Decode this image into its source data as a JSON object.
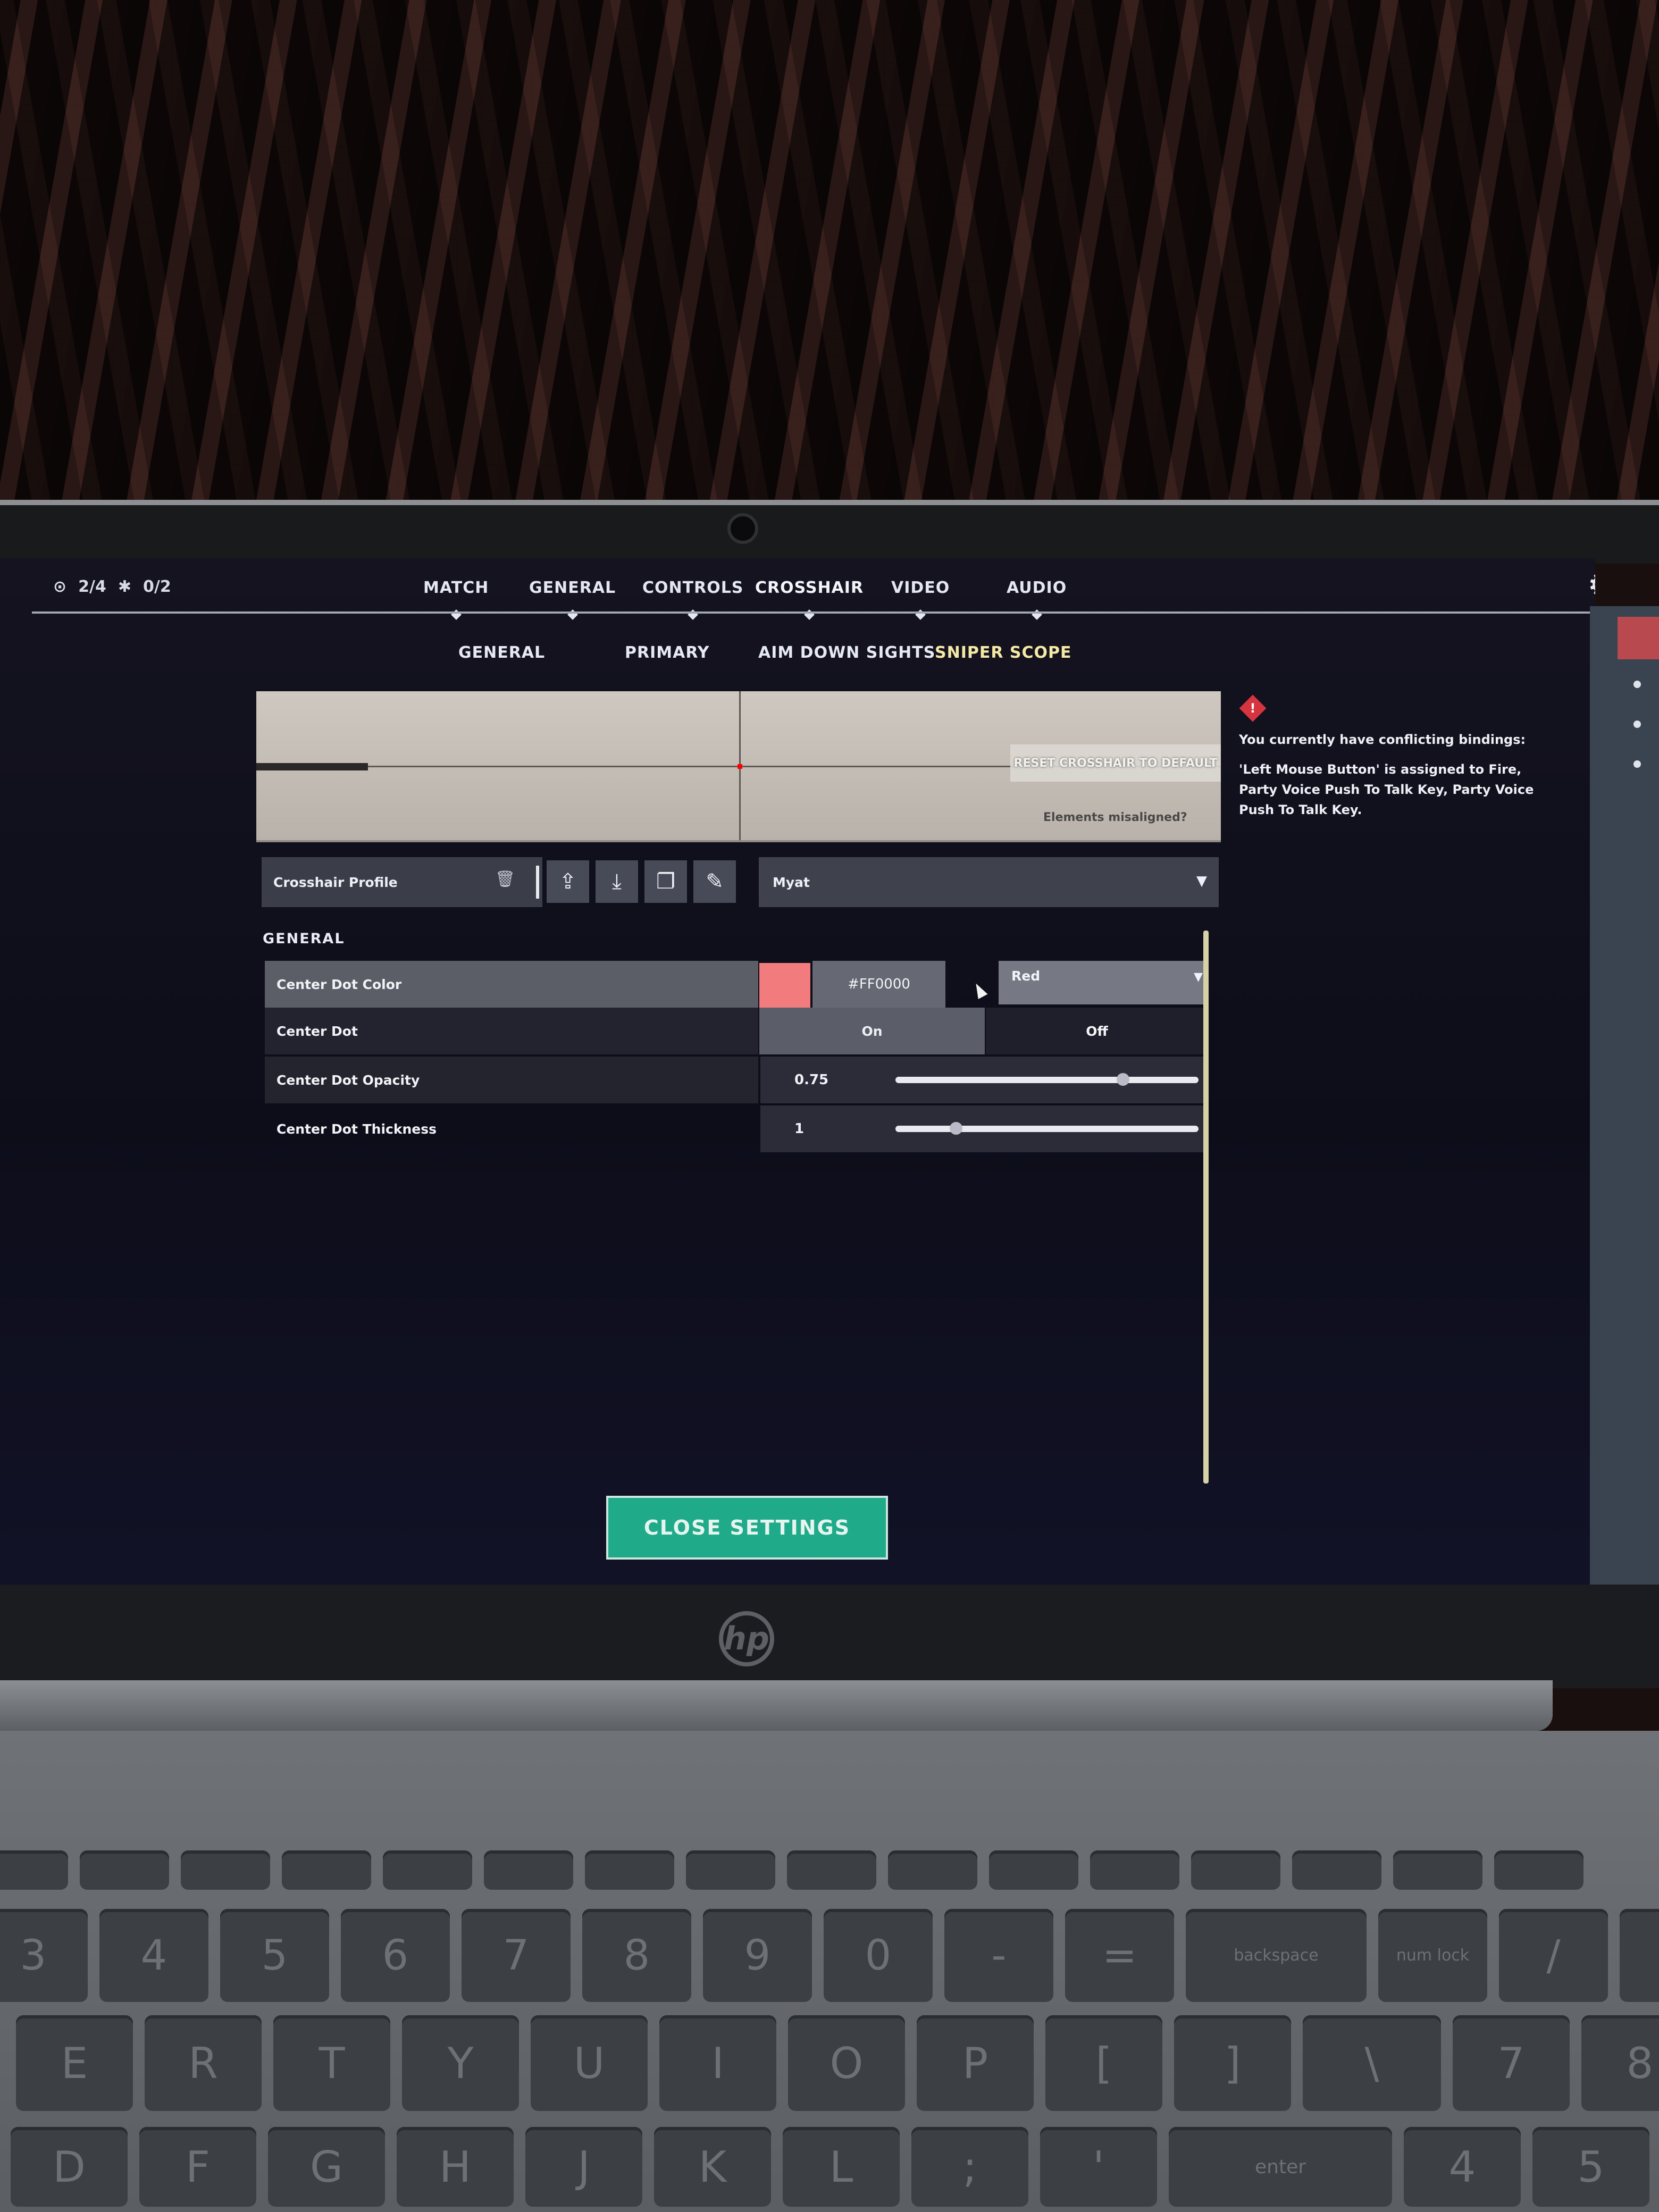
{
  "topbar": {
    "stats": {
      "agents": "2/4",
      "ability": "0/2"
    },
    "tabs": [
      "MATCH",
      "GENERAL",
      "CONTROLS",
      "CROSSHAIR",
      "VIDEO",
      "AUDIO"
    ],
    "active_tab": "CROSSHAIR"
  },
  "subtabs": {
    "items": [
      "GENERAL",
      "PRIMARY",
      "AIM DOWN SIGHTS",
      "SNIPER SCOPE"
    ],
    "active": "SNIPER SCOPE"
  },
  "preview": {
    "reset_label": "RESET CROSSHAIR TO DEFAULT",
    "misaligned_label": "Elements misaligned?"
  },
  "conflict": {
    "heading": "You currently have conflicting bindings:",
    "detail": "'Left Mouse Button' is assigned to Fire, Party Voice Push To Talk Key, Party Voice Push To Talk Key."
  },
  "profile": {
    "label": "Crosshair Profile",
    "selected": "Myat"
  },
  "section": {
    "title": "GENERAL"
  },
  "settings": {
    "center_dot_color": {
      "label": "Center Dot Color",
      "hex": "#FF0000",
      "color_name": "Red",
      "swatch_color": "#FF0000"
    },
    "center_dot": {
      "label": "Center Dot",
      "on_label": "On",
      "off_label": "Off",
      "value": "On"
    },
    "center_dot_opacity": {
      "label": "Center Dot Opacity",
      "value": "0.75",
      "slider_fraction": 0.75
    },
    "center_dot_thickness": {
      "label": "Center Dot Thickness",
      "value": "1",
      "slider_fraction": 0.2
    }
  },
  "footer": {
    "close_label": "CLOSE SETTINGS"
  },
  "laptop": {
    "logo": "hp"
  },
  "keyboard": {
    "number_row": [
      "3",
      "4",
      "5",
      "6",
      "7",
      "8",
      "9",
      "0",
      "-",
      "=",
      "backspace",
      "num lock",
      "/",
      "*"
    ],
    "letter_row": [
      "E",
      "R",
      "T",
      "Y",
      "U",
      "I",
      "O",
      "P",
      "[",
      "]",
      "\\",
      "7",
      "8"
    ],
    "bottom_row": [
      "D",
      "F",
      "G",
      "H",
      "J",
      "K",
      "L",
      ";",
      "'",
      "enter",
      "4",
      "5"
    ]
  }
}
